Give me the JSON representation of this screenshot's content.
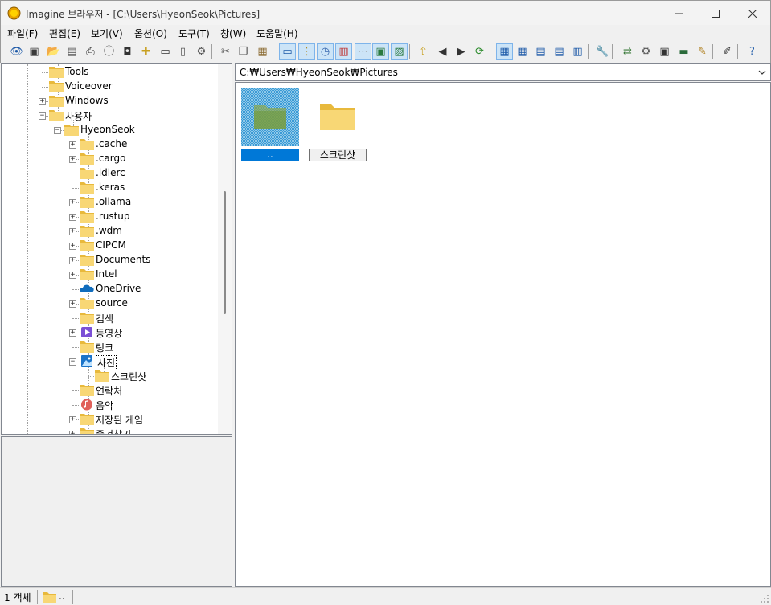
{
  "window": {
    "title": "Imagine 브라우저 - [C:\\Users\\HyeonSeok\\Pictures]",
    "minimize": "—",
    "maximize": "☐",
    "close": "✕"
  },
  "menu": [
    "파일(F)",
    "편집(E)",
    "보기(V)",
    "옵션(O)",
    "도구(T)",
    "창(W)",
    "도움말(H)"
  ],
  "toolbar": {
    "buttons": [
      {
        "name": "view-icon",
        "glyph": "👁"
      },
      {
        "name": "slideshow-icon",
        "glyph": "▣"
      },
      {
        "name": "open-icon",
        "glyph": "📂"
      },
      {
        "name": "save-icon",
        "glyph": "▤"
      },
      {
        "name": "print-icon",
        "glyph": "⎙"
      },
      {
        "name": "info-icon",
        "glyph": "ⓘ"
      },
      {
        "name": "camera-icon",
        "glyph": "◘"
      },
      {
        "name": "new-folder-icon",
        "glyph": "✚"
      },
      {
        "name": "rename-icon",
        "glyph": "▭"
      },
      {
        "name": "delete-icon",
        "glyph": "▯"
      },
      {
        "name": "properties-icon",
        "glyph": "⚙"
      },
      {
        "name": "cut-icon",
        "glyph": "✂"
      },
      {
        "name": "copy-icon",
        "glyph": "❐"
      },
      {
        "name": "paste-icon",
        "glyph": "▦"
      },
      {
        "name": "preview-pane-icon",
        "glyph": "▭"
      },
      {
        "name": "folder-tree-icon",
        "glyph": "⋮"
      },
      {
        "name": "history-icon",
        "glyph": "◷"
      },
      {
        "name": "thumbnail-icon",
        "glyph": "▥"
      },
      {
        "name": "grid-icon",
        "glyph": "⋯"
      },
      {
        "name": "fit-icon",
        "glyph": "▣"
      },
      {
        "name": "image-icon",
        "glyph": "▨"
      },
      {
        "name": "up-folder-icon",
        "glyph": "⇧"
      },
      {
        "name": "back-icon",
        "glyph": "◀"
      },
      {
        "name": "forward-icon",
        "glyph": "▶"
      },
      {
        "name": "refresh-icon",
        "glyph": "⟳"
      },
      {
        "name": "large-icons-icon",
        "glyph": "▦"
      },
      {
        "name": "small-icons-icon",
        "glyph": "▦"
      },
      {
        "name": "list-icon",
        "glyph": "▤"
      },
      {
        "name": "details-icon",
        "glyph": "▤"
      },
      {
        "name": "columns-icon",
        "glyph": "▥"
      },
      {
        "name": "tools-icon",
        "glyph": "🔧"
      },
      {
        "name": "convert-icon",
        "glyph": "⇄"
      },
      {
        "name": "batch-icon",
        "glyph": "⚙"
      },
      {
        "name": "capture-icon",
        "glyph": "▣"
      },
      {
        "name": "filmstrip-icon",
        "glyph": "▬"
      },
      {
        "name": "edit-icon",
        "glyph": "✎"
      },
      {
        "name": "pencil-icon",
        "glyph": "✐"
      },
      {
        "name": "help-icon",
        "glyph": "?"
      }
    ]
  },
  "tree": {
    "items": [
      {
        "label": "Tools",
        "icon": "folder-icon",
        "expander": ""
      },
      {
        "label": "Voiceover",
        "icon": "folder-icon",
        "expander": ""
      },
      {
        "label": "Windows",
        "icon": "folder-icon",
        "expander": "+"
      },
      {
        "label": "사용자",
        "icon": "folder-icon",
        "expander": "−"
      },
      {
        "label": "HyeonSeok",
        "icon": "folder-icon",
        "expander": "−"
      },
      {
        "label": ".cache",
        "icon": "folder-icon",
        "expander": "+"
      },
      {
        "label": ".cargo",
        "icon": "folder-icon",
        "expander": "+"
      },
      {
        "label": ".idlerc",
        "icon": "folder-icon",
        "expander": ""
      },
      {
        "label": ".keras",
        "icon": "folder-icon",
        "expander": ""
      },
      {
        "label": ".ollama",
        "icon": "folder-icon",
        "expander": "+"
      },
      {
        "label": ".rustup",
        "icon": "folder-icon",
        "expander": "+"
      },
      {
        "label": ".wdm",
        "icon": "folder-icon",
        "expander": "+"
      },
      {
        "label": "CIPCM",
        "icon": "folder-icon",
        "expander": "+"
      },
      {
        "label": "Documents",
        "icon": "folder-icon",
        "expander": "+"
      },
      {
        "label": "Intel",
        "icon": "folder-icon",
        "expander": "+"
      },
      {
        "label": "OneDrive",
        "icon": "onedrive-icon",
        "expander": ""
      },
      {
        "label": "source",
        "icon": "folder-icon",
        "expander": "+"
      },
      {
        "label": "검색",
        "icon": "folder-icon",
        "expander": ""
      },
      {
        "label": "동영상",
        "icon": "videos-icon",
        "expander": "+"
      },
      {
        "label": "링크",
        "icon": "folder-icon",
        "expander": ""
      },
      {
        "label": "사진",
        "icon": "pictures-icon",
        "expander": "−"
      },
      {
        "label": "스크린샷",
        "icon": "folder-icon",
        "expander": ""
      },
      {
        "label": "연락처",
        "icon": "folder-icon",
        "expander": ""
      },
      {
        "label": "음악",
        "icon": "music-icon",
        "expander": ""
      },
      {
        "label": "저장된 게임",
        "icon": "folder-icon",
        "expander": "+"
      },
      {
        "label": "즐겨찾기",
        "icon": "folder-icon",
        "expander": "+"
      }
    ]
  },
  "address": {
    "path": "C:₩Users₩HyeonSeok₩Pictures"
  },
  "content": {
    "items": [
      {
        "label": "..",
        "selected": true
      },
      {
        "label": "스크린샷",
        "selected": false
      }
    ]
  },
  "status": {
    "count": "1 객체",
    "current": ".."
  },
  "colors": {
    "selection": "#0078d7",
    "folder": "#f8d775",
    "folder_dark": "#e8b93c"
  }
}
